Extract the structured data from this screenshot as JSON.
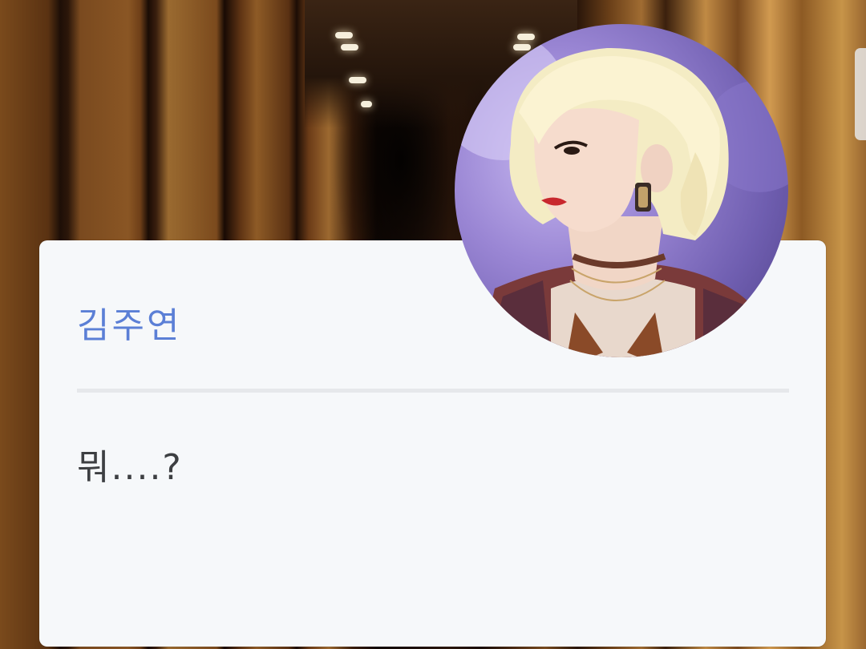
{
  "dialog": {
    "speaker_name": "김주연",
    "message": "뭐....?"
  },
  "avatar": {
    "description_icon": "profile-photo-icon"
  },
  "colors": {
    "name_color": "#5b7fd6",
    "card_bg": "#f6f8fa",
    "text_color": "#3d3f42"
  }
}
